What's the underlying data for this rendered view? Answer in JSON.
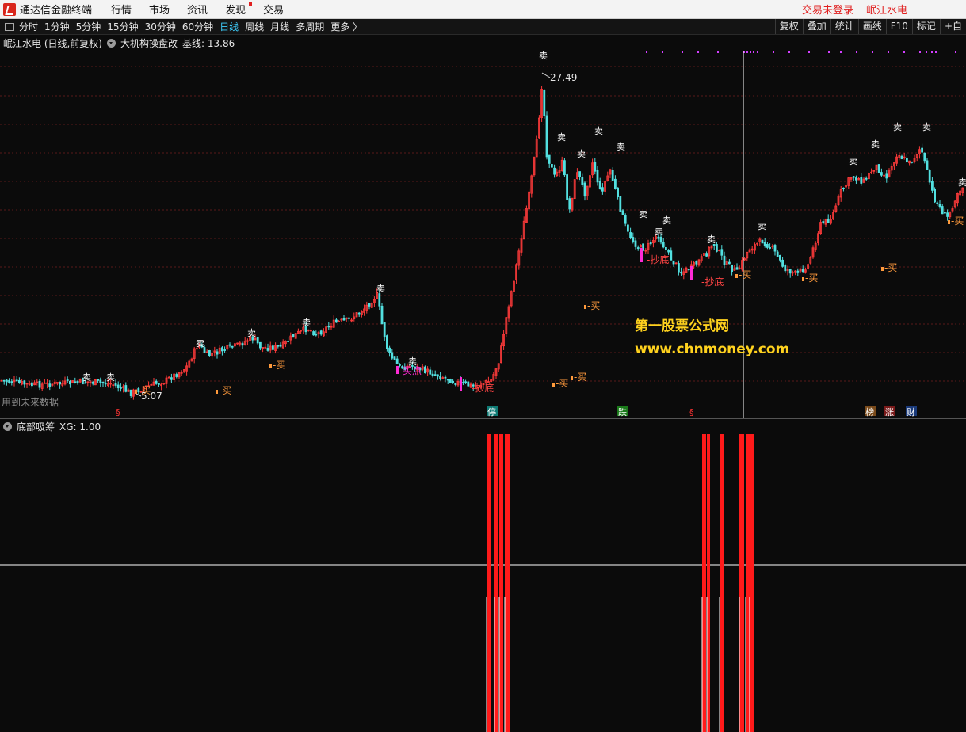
{
  "menubar": {
    "app_title": "通达信金融终端",
    "items": [
      "行情",
      "市场",
      "资讯",
      "发现",
      "交易"
    ],
    "right": [
      "交易未登录",
      "岷江水电"
    ]
  },
  "toolbar": {
    "periods": [
      "分时",
      "1分钟",
      "5分钟",
      "15分钟",
      "30分钟",
      "60分钟",
      "日线",
      "周线",
      "月线",
      "多周期",
      "更多 〉"
    ],
    "active_period": "日线",
    "tools": [
      "复权",
      "叠加",
      "统计",
      "画线",
      "F10",
      "标记",
      "+自"
    ]
  },
  "main_chart": {
    "stock_label": "岷江水电 (日线,前复权)",
    "indicator_name": "大机构操盘改",
    "baseline": "基线: 13.86",
    "high_label": "27.49",
    "low_label": "5.07",
    "future_note": "用到未来数据",
    "signals": {
      "sell": "卖",
      "buy": "买",
      "bottom": "抄底",
      "buy_point": "买点"
    },
    "events": [
      "§",
      "停",
      "跌",
      "§",
      "榜",
      "涨",
      "财"
    ],
    "watermark_title": "第一股票公式网",
    "watermark_url": "www.chnmoney.com"
  },
  "indicator": {
    "name": "底部吸筹",
    "value": "XG: 1.00"
  },
  "colors": {
    "up": "#ff3a3a",
    "down": "#52e0e0",
    "sell": "#ffffff",
    "buy": "#ff9a3c",
    "bottom": "#ff2bd6",
    "bar": "#ff1a1a",
    "watermark": "#ffd21e"
  },
  "chart_data": {
    "type": "candlestick",
    "price_high": 27.49,
    "price_low": 5.07,
    "baseline": 13.86,
    "indicator_value": 1.0,
    "indicator_bar_groups": 7
  }
}
